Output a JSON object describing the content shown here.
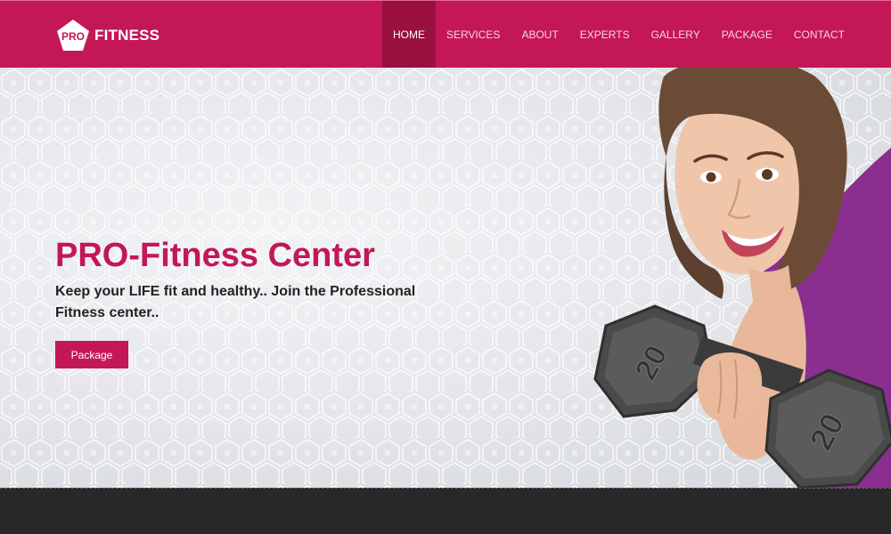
{
  "brand": {
    "logo_mark_text": "PRO",
    "logo_text": "FITNESS",
    "color": "#c41755"
  },
  "nav": {
    "items": [
      {
        "label": "HOME",
        "active": true
      },
      {
        "label": "SERVICES"
      },
      {
        "label": "ABOUT"
      },
      {
        "label": "EXPERTS"
      },
      {
        "label": "GALLERY"
      },
      {
        "label": "PACKAGE"
      },
      {
        "label": "CONTACT"
      }
    ]
  },
  "hero": {
    "title": "PRO-Fitness Center",
    "subtitle": "Keep your LIFE fit and healthy.. Join the Professional Fitness center..",
    "button_label": "Package",
    "dumbbell_weight_1": "20",
    "dumbbell_weight_2": "20"
  },
  "colors": {
    "accent": "#c41755",
    "nav_active": "#99103f",
    "dark_strip": "#282828"
  }
}
